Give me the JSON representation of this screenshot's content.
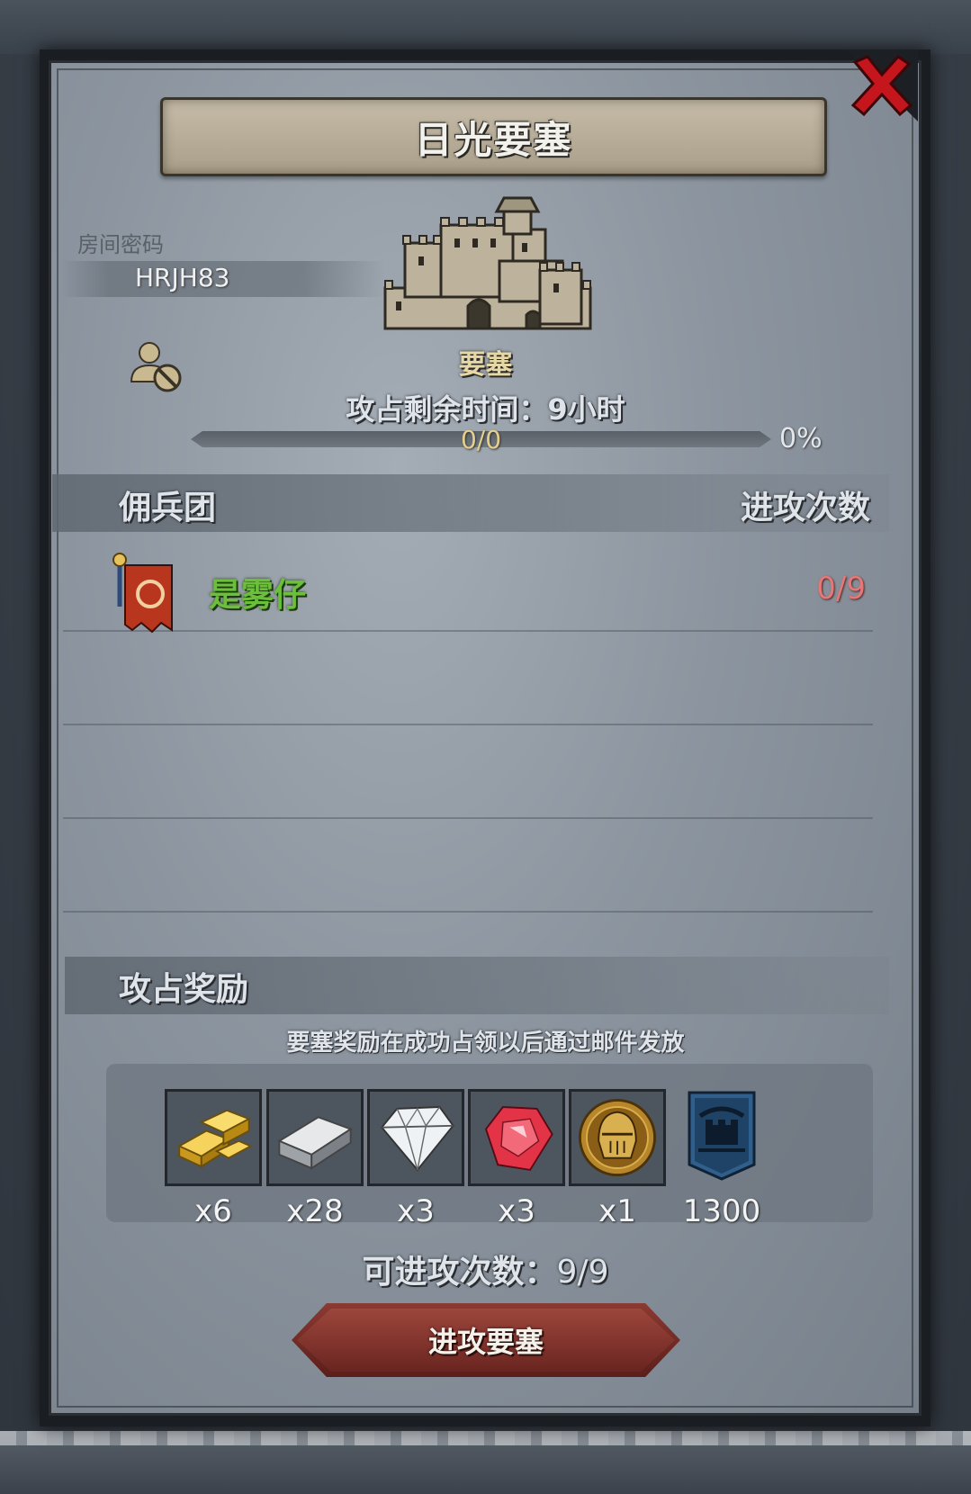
{
  "dialog": {
    "title": "日光要塞",
    "room_label": "房间密码",
    "room_code": "HRJH83",
    "fortress_label": "要塞",
    "time_label": "攻占剩余时间：",
    "time_value": "9小时",
    "progress": {
      "text": "0/0",
      "percent_text": "0%",
      "fraction": 0.0
    }
  },
  "mercenary": {
    "header_left": "佣兵团",
    "header_right": "进攻次数",
    "members": [
      {
        "name": "是雾仔",
        "attacks": "0/9"
      }
    ]
  },
  "rewards": {
    "header": "攻占奖励",
    "note": "要塞奖励在成功占领以后通过邮件发放",
    "items": [
      {
        "icon": "gold-bar-icon",
        "qty": "x6"
      },
      {
        "icon": "iron-ingot-icon",
        "qty": "x28"
      },
      {
        "icon": "diamond-icon",
        "qty": "x3"
      },
      {
        "icon": "ruby-icon",
        "qty": "x3"
      },
      {
        "icon": "knight-helmet-coin-icon",
        "qty": "x1"
      },
      {
        "icon": "fortress-banner-icon",
        "qty": "1300"
      }
    ]
  },
  "footer": {
    "attacks_label": "可进攻次数：",
    "attacks_value": "9/9",
    "attack_button": "进攻要塞"
  },
  "colors": {
    "member_name": "#6bbf3a",
    "attack_count": "#e77777",
    "button": "#8a3a32",
    "close": "#c4161c"
  }
}
